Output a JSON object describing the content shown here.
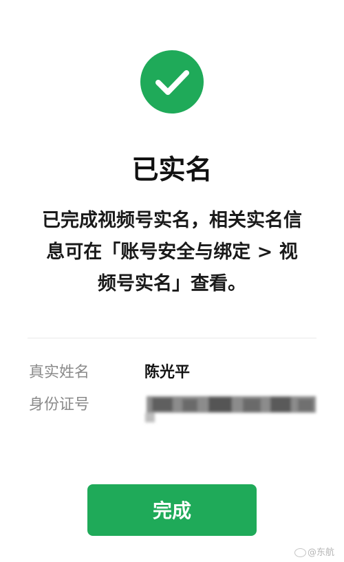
{
  "status": {
    "title": "已实名",
    "description_lines": [
      "已完成视频号实名，相关实名信",
      "息可在「账号安全与绑定 > 视",
      "频号实名」查看。"
    ]
  },
  "info": {
    "name_label": "真实姓名",
    "name_value": "陈光平",
    "id_label": "身份证号"
  },
  "actions": {
    "done_label": "完成"
  },
  "watermark": {
    "text": "@东航"
  },
  "colors": {
    "accent": "#1faa59"
  },
  "icons": {
    "status": "check-icon"
  }
}
